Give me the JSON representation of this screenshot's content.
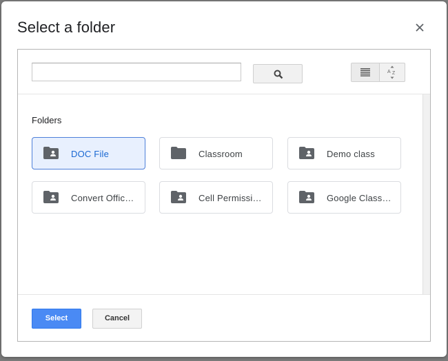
{
  "dialog": {
    "title": "Select a folder"
  },
  "toolbar": {
    "search_value": "",
    "search_placeholder": "",
    "search_icon": "search-icon",
    "list_view_icon": "list-view-icon",
    "sort_icon": "sort-az-icon"
  },
  "content": {
    "section_label": "Folders",
    "folders": [
      {
        "name": "DOC File",
        "icon": "shared-folder-icon",
        "selected": true
      },
      {
        "name": "Classroom",
        "icon": "folder-icon",
        "selected": false
      },
      {
        "name": "Demo class",
        "icon": "shared-folder-icon",
        "selected": false
      },
      {
        "name": "Convert Office Files",
        "icon": "shared-folder-icon",
        "selected": false
      },
      {
        "name": "Cell Permissions",
        "icon": "shared-folder-icon",
        "selected": false
      },
      {
        "name": "Google Classroom",
        "icon": "shared-folder-icon",
        "selected": false
      }
    ]
  },
  "footer": {
    "select_label": "Select",
    "cancel_label": "Cancel"
  },
  "colors": {
    "accent": "#4a8af4",
    "selected_bg": "#e8f0fe",
    "selected_text": "#1967d2",
    "icon_gray": "#5f6368"
  }
}
